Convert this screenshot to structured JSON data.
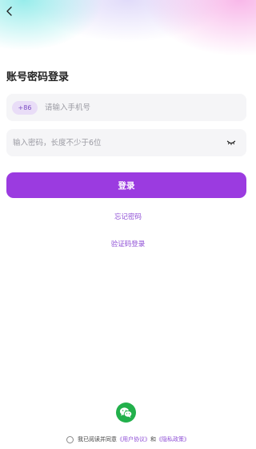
{
  "header": {
    "back_icon": "chevron-left-icon"
  },
  "page": {
    "title": "账号密码登录"
  },
  "phone": {
    "country_code": "+86",
    "placeholder": "请输入手机号",
    "value": ""
  },
  "password": {
    "placeholder": "输入密码，长度不少于6位",
    "value": "",
    "toggle_icon": "eye-closed-icon"
  },
  "actions": {
    "login_label": "登录",
    "forgot_password": "忘记密码",
    "code_login": "验证码登录"
  },
  "social": {
    "wechat_icon": "wechat-icon"
  },
  "agreement": {
    "prefix": "我已阅读并同意",
    "user_agreement": "《用户协议》",
    "and": "和",
    "privacy_policy": "《隐私政策》"
  },
  "colors": {
    "accent": "#9b3be0",
    "link": "#8f4fd6",
    "badge_bg": "#e9ddf7",
    "wechat": "#22b04b",
    "field_bg": "#f5f5f7"
  }
}
